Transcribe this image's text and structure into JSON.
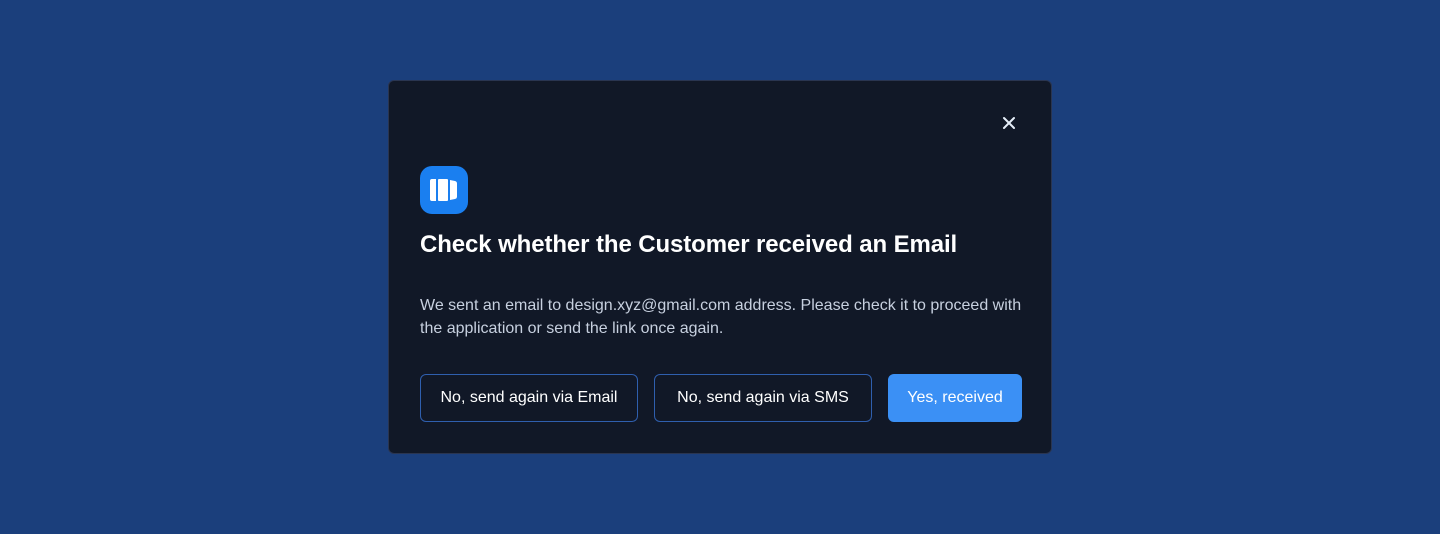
{
  "dialog": {
    "close_icon": "close-icon",
    "logo_icon": "app-logo-icon",
    "title": "Check whether the Customer received an Email",
    "description": "We sent an email to design.xyz@gmail.com address. Please check it to proceed with the application or send the link once again.",
    "buttons": {
      "send_email_label": "No, send again via Email",
      "send_sms_label": "No, send again via SMS",
      "confirm_label": "Yes, received"
    }
  },
  "colors": {
    "background": "#1b3f7c",
    "modal_background": "#111827",
    "accent": "#3b90f5",
    "logo": "#1a7ff0",
    "outline_button_border": "#2f5fae"
  }
}
